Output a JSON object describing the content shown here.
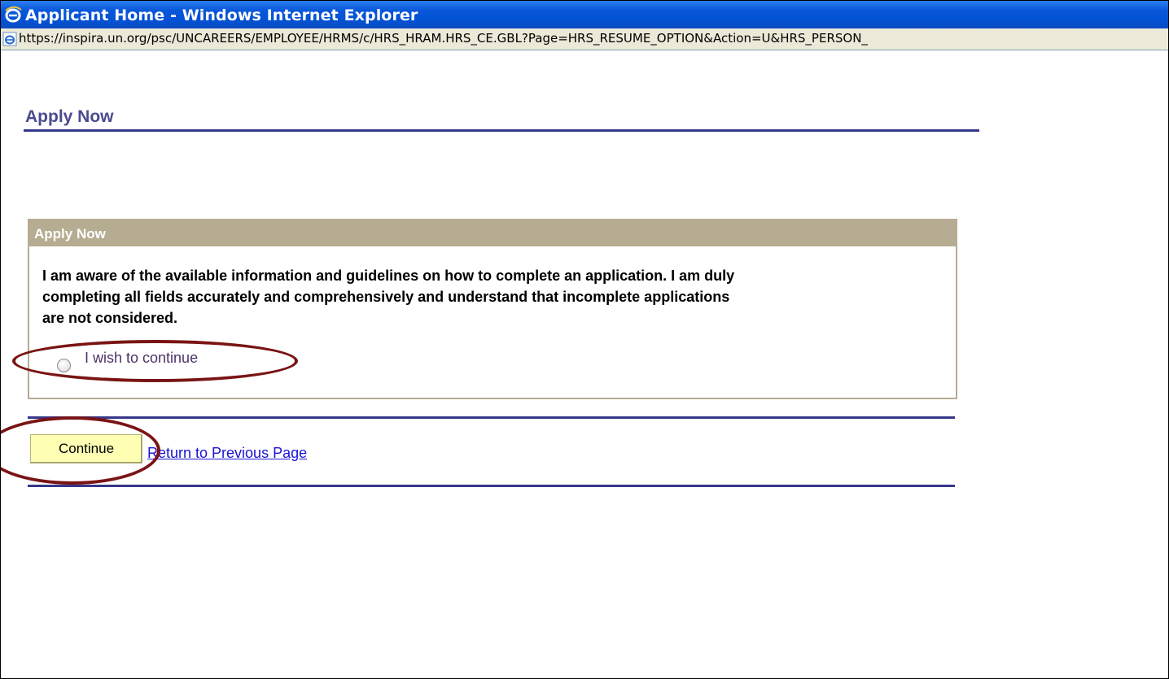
{
  "window": {
    "title": "Applicant Home - Windows Internet Explorer",
    "url": "https://inspira.un.org/psc/UNCAREERS/EMPLOYEE/HRMS/c/HRS_HRAM.HRS_CE.GBL?Page=HRS_RESUME_OPTION&Action=U&HRS_PERSON_"
  },
  "page": {
    "title": "Apply Now"
  },
  "panel": {
    "header": "Apply Now",
    "statement_line1": "I am aware of the available information and guidelines on how to complete an application. I am duly",
    "statement_line2": "completing all fields accurately and comprehensively and understand that incomplete applications",
    "statement_line3": "are not considered.",
    "option_label": "I wish to continue"
  },
  "actions": {
    "continue_label": "Continue",
    "return_link": "Return to Previous Page"
  },
  "colors": {
    "title_bar": "#0a58da",
    "heading": "#4b4a8f",
    "rule": "#36378a",
    "panel_header": "#b6ac91",
    "button_bg": "#ffffb4",
    "link": "#1a14d4",
    "highlight_ellipse": "#7a1414"
  },
  "icons": {
    "title_icon": "ie-logo-icon",
    "address_icon": "ie-page-icon"
  }
}
